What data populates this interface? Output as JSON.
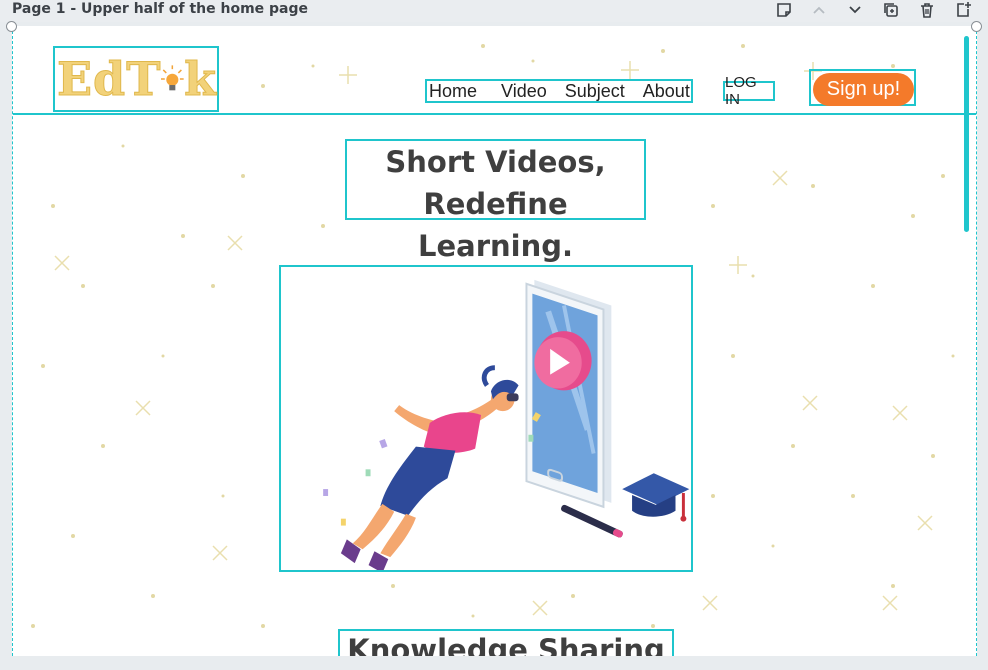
{
  "editor": {
    "page_title": "Page 1 - Upper half of the home page",
    "tools": [
      "note-icon",
      "chevron-up-icon",
      "chevron-down-icon",
      "duplicate-page-icon",
      "trash-icon",
      "add-page-icon"
    ]
  },
  "site": {
    "logo_text": "EdT k",
    "nav": [
      "Home",
      "Video",
      "Subject",
      "About"
    ],
    "login_label": "LOG IN",
    "signup_label": "Sign up!",
    "headline_line1": "Short Videos,",
    "headline_line2": "Redefine Learning.",
    "section_heading": "Knowledge Sharing",
    "colors": {
      "accent": "#1fc5cc",
      "signup": "#f47a2a",
      "logo": "#f2d27a",
      "text": "#3f3f3f"
    }
  }
}
